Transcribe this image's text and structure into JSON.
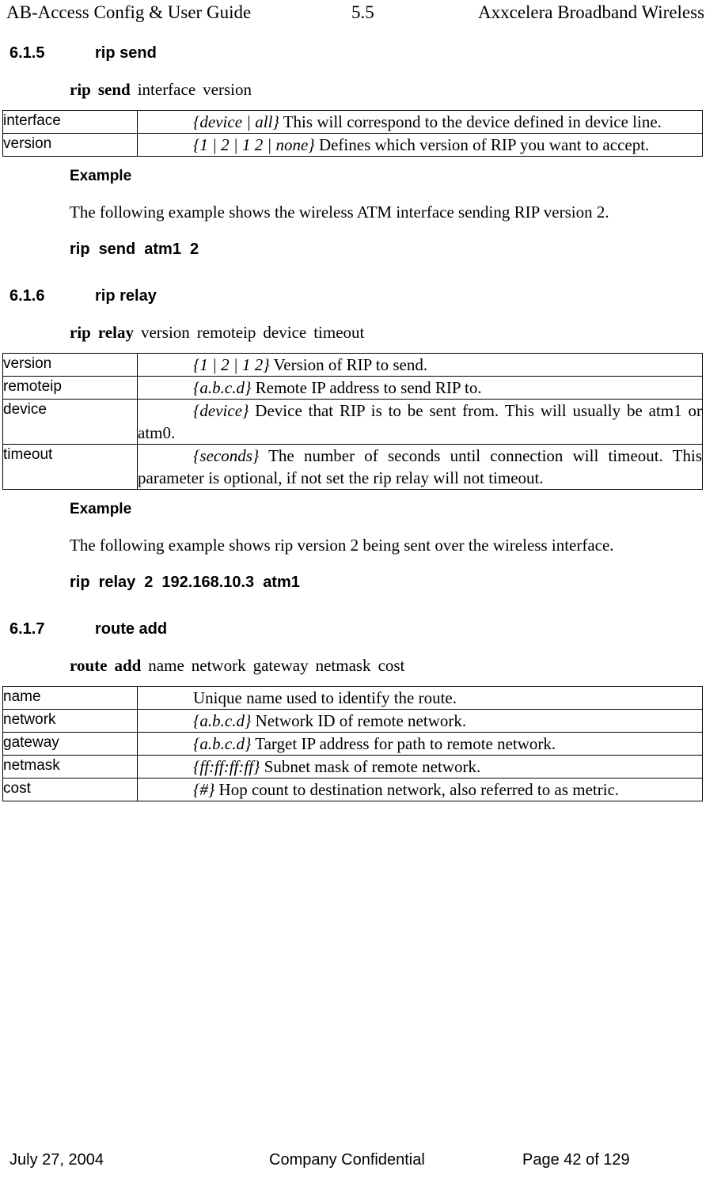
{
  "header": {
    "left": "AB-Access Config & User Guide",
    "center": "5.5",
    "right": "Axxcelera Broadband Wireless"
  },
  "footer": {
    "left": "July 27, 2004",
    "center": "Company Confidential",
    "right": "Page 42 of 129"
  },
  "sections": [
    {
      "number": "6.1.5",
      "title": "rip send",
      "syntax": {
        "command_1": "rip",
        "command_2": "send",
        "params": [
          "interface",
          "version"
        ]
      },
      "table": [
        {
          "name": "interface",
          "syntax": "{device | all}",
          "text": "This will correspond to the device defined in device line."
        },
        {
          "name": "version",
          "syntax": "{1 | 2 | 1 2 | none}",
          "text": "Defines which version of RIP you want to accept."
        }
      ],
      "example_label": "Example",
      "example_text": "The following example shows the wireless ATM interface sending RIP version 2.",
      "example_command": [
        "rip",
        "send",
        "atm1",
        "2"
      ]
    },
    {
      "number": "6.1.6",
      "title": "rip relay",
      "syntax": {
        "command_1": "rip",
        "command_2": "relay",
        "params": [
          "version",
          "remoteip",
          "device",
          "timeout"
        ]
      },
      "table": [
        {
          "name": "version",
          "syntax": "{1 | 2 | 1 2}",
          "text": "Version of RIP to send."
        },
        {
          "name": "remoteip",
          "syntax": "{a.b.c.d}",
          "text": "Remote IP address to send RIP to."
        },
        {
          "name": "device",
          "syntax": "{device}",
          "text": "Device that RIP is to be sent from. This will usually be atm1 or atm0."
        },
        {
          "name": "timeout",
          "syntax": "{seconds}",
          "text": "The number of seconds until connection will timeout. This parameter is optional, if not set the rip relay will not timeout."
        }
      ],
      "example_label": "Example",
      "example_text": "The following example shows rip version 2 being sent over the wireless interface.",
      "example_command": [
        "rip",
        "relay",
        "2",
        "192.168.10.3",
        "atm1"
      ]
    },
    {
      "number": "6.1.7",
      "title": "route add",
      "syntax": {
        "command_1": "route",
        "command_2": "add",
        "params": [
          "name",
          "network",
          "gateway",
          "netmask",
          "cost"
        ]
      },
      "table": [
        {
          "name": "name",
          "syntax": "",
          "text": "Unique name used to identify the route."
        },
        {
          "name": "network",
          "syntax": "{a.b.c.d}",
          "text": "Network ID of remote network."
        },
        {
          "name": "gateway",
          "syntax": "{a.b.c.d}",
          "text": "Target IP address for path to remote network."
        },
        {
          "name": "netmask",
          "syntax": "{ff:ff:ff:ff}",
          "text": "Subnet mask of remote network."
        },
        {
          "name": "cost",
          "syntax": "{#}",
          "text": "Hop count to destination network, also referred to as metric."
        }
      ]
    }
  ]
}
